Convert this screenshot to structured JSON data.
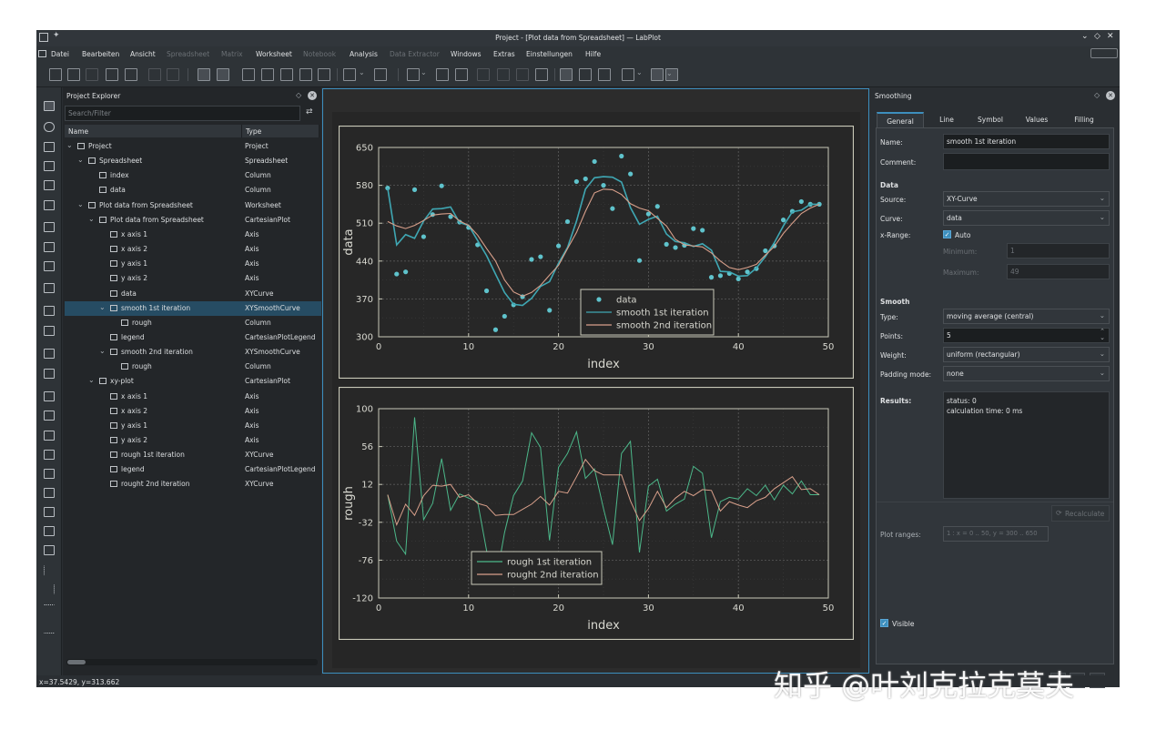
{
  "window": {
    "title": "Project - [Plot data from Spreadsheet] — LabPlot"
  },
  "menu": [
    {
      "label": "Datei",
      "enabled": true
    },
    {
      "label": "Bearbeiten",
      "enabled": true
    },
    {
      "label": "Ansicht",
      "enabled": true
    },
    {
      "label": "Spreadsheet",
      "enabled": false
    },
    {
      "label": "Matrix",
      "enabled": false
    },
    {
      "label": "Worksheet",
      "enabled": true
    },
    {
      "label": "Notebook",
      "enabled": false
    },
    {
      "label": "Analysis",
      "enabled": true
    },
    {
      "label": "Data Extractor",
      "enabled": false
    },
    {
      "label": "Windows",
      "enabled": true
    },
    {
      "label": "Extras",
      "enabled": true
    },
    {
      "label": "Einstellungen",
      "enabled": true
    },
    {
      "label": "Hilfe",
      "enabled": true
    }
  ],
  "explorer": {
    "title": "Project Explorer",
    "search_placeholder": "Search/Filter",
    "col_name": "Name",
    "col_type": "Type",
    "rows": [
      {
        "name": "Project",
        "type": "Project",
        "depth": 0,
        "expanded": true,
        "selected": false
      },
      {
        "name": "Spreadsheet",
        "type": "Spreadsheet",
        "depth": 1,
        "expanded": true,
        "selected": false
      },
      {
        "name": "index",
        "type": "Column",
        "depth": 2,
        "selected": false
      },
      {
        "name": "data",
        "type": "Column",
        "depth": 2,
        "selected": false
      },
      {
        "name": "Plot data from Spreadsheet",
        "type": "Worksheet",
        "depth": 1,
        "expanded": true,
        "selected": false
      },
      {
        "name": "Plot data from Spreadsheet",
        "type": "CartesianPlot",
        "depth": 2,
        "expanded": true,
        "selected": false
      },
      {
        "name": "x axis 1",
        "type": "Axis",
        "depth": 3,
        "selected": false
      },
      {
        "name": "x axis 2",
        "type": "Axis",
        "depth": 3,
        "selected": false
      },
      {
        "name": "y axis 1",
        "type": "Axis",
        "depth": 3,
        "selected": false
      },
      {
        "name": "y axis 2",
        "type": "Axis",
        "depth": 3,
        "selected": false
      },
      {
        "name": "data",
        "type": "XYCurve",
        "depth": 3,
        "selected": false
      },
      {
        "name": "smooth 1st iteration",
        "type": "XYSmoothCurve",
        "depth": 3,
        "expanded": true,
        "selected": true
      },
      {
        "name": "rough",
        "type": "Column",
        "depth": 4,
        "selected": false
      },
      {
        "name": "legend",
        "type": "CartesianPlotLegend",
        "depth": 3,
        "selected": false
      },
      {
        "name": "smooth 2nd iteration",
        "type": "XYSmoothCurve",
        "depth": 3,
        "expanded": true,
        "selected": false
      },
      {
        "name": "rough",
        "type": "Column",
        "depth": 4,
        "selected": false
      },
      {
        "name": "xy-plot",
        "type": "CartesianPlot",
        "depth": 2,
        "expanded": true,
        "selected": false
      },
      {
        "name": "x axis 1",
        "type": "Axis",
        "depth": 3,
        "selected": false
      },
      {
        "name": "x axis 2",
        "type": "Axis",
        "depth": 3,
        "selected": false
      },
      {
        "name": "y axis 1",
        "type": "Axis",
        "depth": 3,
        "selected": false
      },
      {
        "name": "y axis 2",
        "type": "Axis",
        "depth": 3,
        "selected": false
      },
      {
        "name": "rough 1st iteration",
        "type": "XYCurve",
        "depth": 3,
        "selected": false
      },
      {
        "name": "legend",
        "type": "CartesianPlotLegend",
        "depth": 3,
        "selected": false
      },
      {
        "name": "rought 2nd iteration",
        "type": "XYCurve",
        "depth": 3,
        "selected": false
      }
    ]
  },
  "smoothing": {
    "title": "Smoothing",
    "tabs": [
      "General",
      "Line",
      "Symbol",
      "Values",
      "Filling"
    ],
    "active_tab": "General",
    "name_label": "Name:",
    "name_value": "smooth 1st iteration",
    "comment_label": "Comment:",
    "comment_value": "",
    "data_header": "Data",
    "source_label": "Source:",
    "source_value": "XY-Curve",
    "curve_label": "Curve:",
    "curve_value": "data",
    "xrange_label": "x-Range:",
    "auto_label": "Auto",
    "auto_checked": true,
    "minimum_label": "Minimum:",
    "minimum_value": "1",
    "maximum_label": "Maximum:",
    "maximum_value": "49",
    "smooth_header": "Smooth",
    "type_label": "Type:",
    "type_value": "moving average (central)",
    "points_label": "Points:",
    "points_value": "5",
    "weight_label": "Weight:",
    "weight_value": "uniform (rectangular)",
    "padding_label": "Padding mode:",
    "padding_value": "none",
    "results_label": "Results:",
    "results_status": "status: 0",
    "results_time": "calculation time: 0 ms",
    "recalculate_label": "Recalculate",
    "plot_ranges_label": "Plot ranges:",
    "plot_ranges_value": "1 : x = 0 .. 50, y = 300 .. 650",
    "visible_label": "Visible",
    "visible_checked": true
  },
  "statusbar": {
    "coords": "x=37.5429, y=313.662"
  },
  "watermark": "知乎 @叶刘克拉克莫夫",
  "colors": {
    "data": "#5fc3cc",
    "smooth1": "#3fa7b3",
    "smooth2": "#d9a08b",
    "rough1": "#4cb88a",
    "rough2": "#d9a08b",
    "accent": "#3d8fbe"
  },
  "chart_data": [
    {
      "type": "scatter",
      "title": "",
      "xlabel": "index",
      "ylabel": "data",
      "xlim": [
        0,
        50
      ],
      "ylim": [
        300,
        650
      ],
      "xticks": [
        0,
        10,
        20,
        30,
        40,
        50
      ],
      "yticks": [
        300,
        370,
        440,
        510,
        580,
        650
      ],
      "legend": "center-right",
      "grid": true,
      "series": [
        {
          "name": "data",
          "style": "points",
          "x": [
            1,
            2,
            3,
            4,
            5,
            6,
            7,
            8,
            9,
            10,
            11,
            12,
            13,
            14,
            15,
            16,
            17,
            18,
            19,
            20,
            21,
            22,
            23,
            24,
            25,
            26,
            27,
            28,
            29,
            30,
            31,
            32,
            33,
            34,
            35,
            36,
            37,
            38,
            39,
            40,
            41,
            42,
            43,
            44,
            45,
            46,
            47,
            48,
            49
          ],
          "y": [
            575,
            416,
            420,
            572,
            485,
            526,
            579,
            522,
            512,
            502,
            470,
            385,
            313,
            338,
            359,
            374,
            443,
            448,
            349,
            468,
            513,
            587,
            592,
            624,
            580,
            537,
            634,
            601,
            441,
            527,
            541,
            471,
            465,
            469,
            500,
            497,
            410,
            413,
            417,
            407,
            420,
            426,
            459,
            468,
            516,
            532,
            550,
            545,
            545
          ]
        },
        {
          "name": "smooth 1st iteration",
          "style": "line",
          "x": [
            1,
            2,
            3,
            4,
            5,
            6,
            7,
            8,
            9,
            10,
            11,
            12,
            13,
            14,
            15,
            16,
            17,
            18,
            19,
            20,
            21,
            22,
            23,
            24,
            25,
            26,
            27,
            28,
            29,
            30,
            31,
            32,
            33,
            34,
            35,
            36,
            37,
            38,
            39,
            40,
            41,
            42,
            43,
            44,
            45,
            46,
            47,
            48,
            49
          ],
          "y": [
            575,
            470,
            489,
            482,
            514,
            536,
            537,
            540,
            511,
            506,
            478,
            450,
            416,
            382,
            360,
            358,
            371,
            393,
            402,
            436,
            465,
            514,
            573,
            594,
            596,
            595,
            586,
            539,
            508,
            517,
            523,
            490,
            476,
            474,
            467,
            472,
            460,
            421,
            420,
            412,
            413,
            427,
            448,
            474,
            505,
            531,
            534,
            545,
            545
          ]
        },
        {
          "name": "smooth 2nd iteration",
          "style": "line",
          "x": [
            1,
            2,
            3,
            4,
            5,
            6,
            7,
            8,
            9,
            10,
            11,
            12,
            13,
            14,
            15,
            16,
            17,
            18,
            19,
            20,
            21,
            22,
            23,
            24,
            25,
            26,
            27,
            28,
            29,
            30,
            31,
            32,
            33,
            34,
            35,
            36,
            37,
            38,
            39,
            40,
            41,
            42,
            43,
            44,
            45,
            46,
            47,
            48,
            49
          ],
          "y": [
            513,
            505,
            500,
            506,
            515,
            525,
            527,
            528,
            514,
            506,
            488,
            463,
            440,
            405,
            383,
            375,
            382,
            395,
            414,
            432,
            463,
            493,
            532,
            566,
            573,
            572,
            563,
            546,
            538,
            533,
            519,
            505,
            480,
            470,
            468,
            466,
            455,
            440,
            428,
            424,
            428,
            434,
            451,
            467,
            491,
            510,
            528,
            538,
            545
          ]
        }
      ]
    },
    {
      "type": "line",
      "title": "",
      "xlabel": "index",
      "ylabel": "rough",
      "xlim": [
        0,
        50
      ],
      "ylim": [
        -120,
        100
      ],
      "xticks": [
        0,
        10,
        20,
        30,
        40,
        50
      ],
      "yticks": [
        -120,
        -76,
        -32,
        12,
        56,
        100
      ],
      "legend": "bottom-center",
      "grid": true,
      "series": [
        {
          "name": "rough 1st iteration",
          "x": [
            1,
            2,
            3,
            4,
            5,
            6,
            7,
            8,
            9,
            10,
            11,
            12,
            13,
            14,
            15,
            16,
            17,
            18,
            19,
            20,
            21,
            22,
            23,
            24,
            25,
            26,
            27,
            28,
            29,
            30,
            31,
            32,
            33,
            34,
            35,
            36,
            37,
            38,
            39,
            40,
            41,
            42,
            43,
            44,
            45,
            46,
            47,
            48,
            49
          ],
          "y": [
            0,
            -54,
            -69,
            90,
            -29,
            -10,
            42,
            -18,
            1,
            -4,
            -8,
            -65,
            -103,
            -44,
            -1,
            16,
            72,
            55,
            -53,
            32,
            48,
            73,
            19,
            30,
            -16,
            -58,
            48,
            62,
            -67,
            10,
            18,
            -19,
            -11,
            -5,
            33,
            25,
            -50,
            -8,
            -3,
            -5,
            7,
            -1,
            11,
            -6,
            11,
            1,
            16,
            0,
            0
          ]
        },
        {
          "name": "rought 2nd iteration",
          "x": [
            1,
            2,
            3,
            4,
            5,
            6,
            7,
            8,
            9,
            10,
            11,
            12,
            13,
            14,
            15,
            16,
            17,
            18,
            19,
            20,
            21,
            22,
            23,
            24,
            25,
            26,
            27,
            28,
            29,
            30,
            31,
            32,
            33,
            34,
            35,
            36,
            37,
            38,
            39,
            40,
            41,
            42,
            43,
            44,
            45,
            46,
            47,
            48,
            49
          ],
          "y": [
            0,
            -35,
            -11,
            -24,
            -1,
            11,
            10,
            12,
            -3,
            0,
            -10,
            -13,
            -24,
            -23,
            -23,
            -17,
            -11,
            -2,
            -12,
            4,
            2,
            21,
            41,
            28,
            23,
            23,
            23,
            -7,
            -30,
            -16,
            4,
            -15,
            -4,
            4,
            -1,
            6,
            5,
            -19,
            -8,
            -12,
            -15,
            -7,
            -3,
            7,
            14,
            21,
            6,
            7,
            0
          ]
        }
      ]
    }
  ]
}
